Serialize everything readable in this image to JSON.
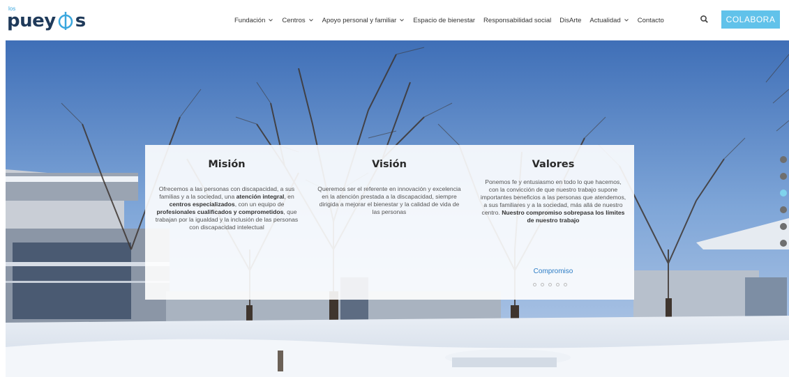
{
  "header": {
    "logo": {
      "small": "los",
      "main_left": "puey",
      "main_right": "s"
    },
    "nav": [
      {
        "label": "Fundación",
        "dropdown": true
      },
      {
        "label": "Centros",
        "dropdown": true
      },
      {
        "label": "Apoyo personal y familiar",
        "dropdown": true
      },
      {
        "label": "Espacio de bienestar",
        "dropdown": false
      },
      {
        "label": "Responsabilidad social",
        "dropdown": false
      },
      {
        "label": "DisArte",
        "dropdown": false
      },
      {
        "label": "Actualidad",
        "dropdown": true
      },
      {
        "label": "Contacto",
        "dropdown": false
      }
    ],
    "search_icon": "search-icon",
    "cta_label": "COLABORA"
  },
  "panel": {
    "mision": {
      "title": "Misión",
      "t1": "Ofrecemos a las personas con discapacidad, a sus familias y a la sociedad, una ",
      "b1": "atención integral",
      "t2": ", en ",
      "b2": "centros especializados",
      "t3": ", con un equipo de ",
      "b3": "profesionales cualificados y comprometidos",
      "t4": ", que trabajan por la igualdad y la inclusión de las personas con discapacidad intelectual"
    },
    "vision": {
      "title": "Visión",
      "text": "Queremos ser el referente en innovación y excelencia en la atención prestada a la discapacidad, siempre dirigida a mejorar el bienestar y la calidad de vida de las personas"
    },
    "valores": {
      "title": "Valores",
      "t1": "Ponemos fe y entusiasmo en todo lo que hacemos, con la convicción de que nuestro trabajo supone importantes beneficios a las personas que atendemos, a sus familiares y a la sociedad, más allá de nuestro centro. ",
      "b1": "Nuestro compromiso sobrepasa los límites de nuestro trabajo"
    },
    "link_label": "Compromiso",
    "carousel_dots": 5
  },
  "side_nav": {
    "count": 6,
    "active_index": 2
  },
  "colors": {
    "accent": "#61c2ea",
    "link": "#2b7cc5",
    "logo_dark": "#1f3a5a",
    "side_dot_active": "#7fd3ec"
  }
}
